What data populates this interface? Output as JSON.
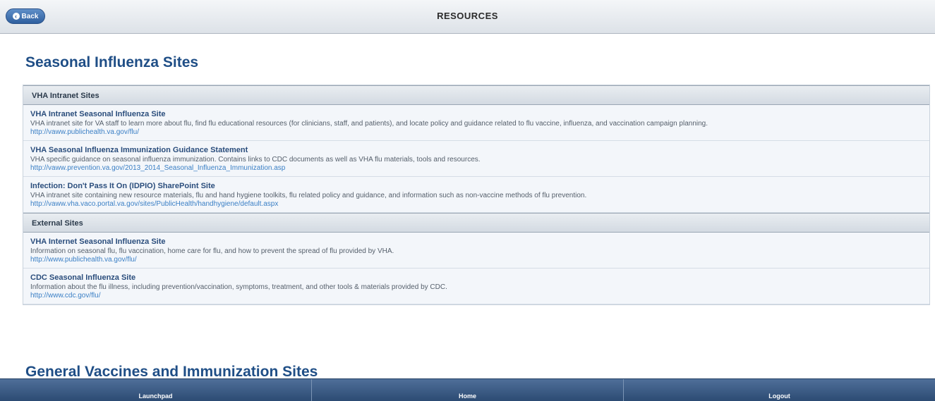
{
  "header": {
    "back_label": "Back",
    "title": "RESOURCES"
  },
  "sections": [
    {
      "title": "Seasonal Influenza Sites",
      "groups": [
        {
          "label": "VHA Intranet Sites",
          "items": [
            {
              "title": "VHA Intranet Seasonal Influenza Site",
              "description": "VHA intranet site for VA staff to learn more about flu, find flu educational resources (for clinicians, staff, and patients), and locate policy and guidance related to flu vaccine, influenza, and vaccination campaign planning.",
              "link": "http://vaww.publichealth.va.gov/flu/"
            },
            {
              "title": "VHA Seasonal Influenza Immunization Guidance Statement",
              "description": "VHA specific guidance on seasonal influenza immunization. Contains links to CDC documents as well as VHA flu materials, tools and resources.",
              "link": "http://vaww.prevention.va.gov/2013_2014_Seasonal_Influenza_Immunization.asp"
            },
            {
              "title": "Infection: Don't Pass It On (IDPIO) SharePoint Site",
              "description": "VHA intranet site containing new resource materials, flu and hand hygiene toolkits, flu related policy and guidance, and information such as non-vaccine methods of flu prevention.",
              "link": "http://vaww.vha.vaco.portal.va.gov/sites/PublicHealth/handhygiene/default.aspx"
            }
          ]
        },
        {
          "label": "External Sites",
          "items": [
            {
              "title": "VHA Internet Seasonal Influenza Site",
              "description": "Information on seasonal flu, flu vaccination, home care for flu, and how to prevent the spread of flu provided by VHA.",
              "link": "http://www.publichealth.va.gov/flu/"
            },
            {
              "title": "CDC Seasonal Influenza Site",
              "description": "Information about the flu illness, including prevention/vaccination, symptoms, treatment, and other tools & materials provided by CDC.",
              "link": "http://www.cdc.gov/flu/"
            }
          ]
        }
      ]
    },
    {
      "title": "General Vaccines and Immunization Sites"
    }
  ],
  "bottom_nav": {
    "items": [
      "Launchpad",
      "Home",
      "Logout"
    ]
  },
  "colors": {
    "heading": "#1f4e86",
    "link": "#3a7fc5",
    "nav_bg": "#2c4b73"
  }
}
